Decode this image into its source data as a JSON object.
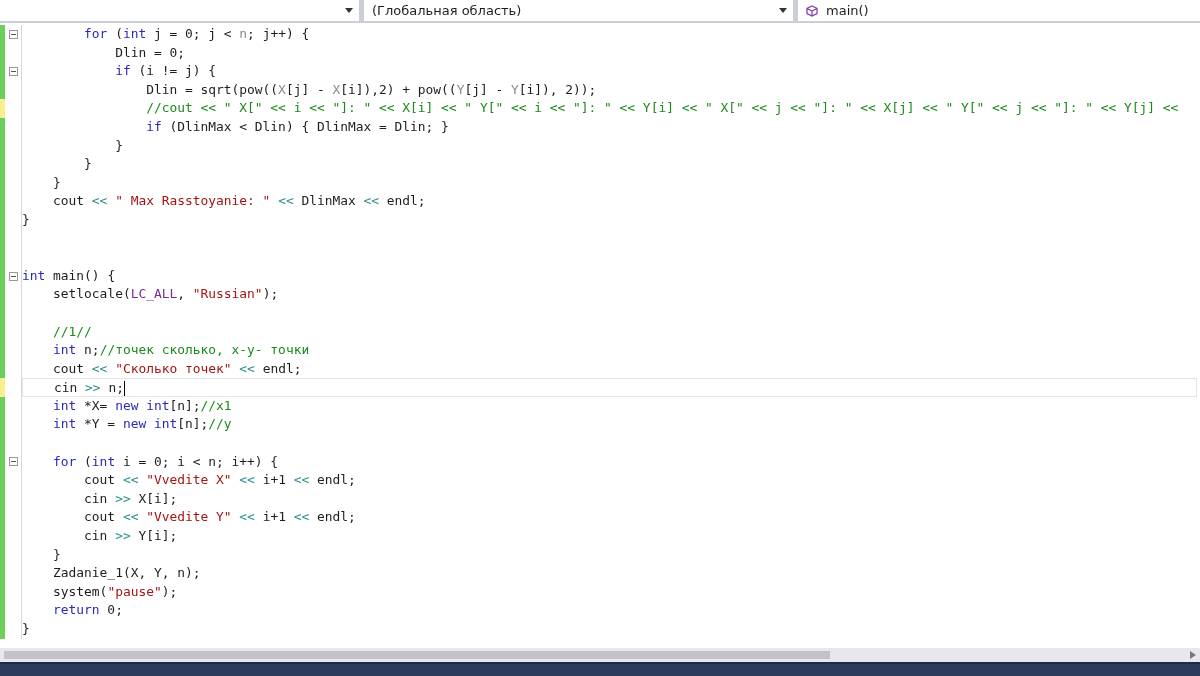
{
  "navigation_bar": {
    "scope": "(Глобальная область)",
    "member": "main()"
  },
  "editor": {
    "lines": [
      {
        "unsaved": false,
        "fold": true,
        "tokens": [
          {
            "kind": "keyword",
            "text": "        for"
          },
          {
            "kind": "plain",
            "text": " ("
          },
          {
            "kind": "keyword",
            "text": "int"
          },
          {
            "kind": "plain",
            "text": " j = 0; j < "
          },
          {
            "kind": "param",
            "text": "n"
          },
          {
            "kind": "plain",
            "text": "; j++) {"
          }
        ]
      },
      {
        "unsaved": false,
        "tokens": [
          {
            "kind": "plain",
            "text": "            Dlin = 0;"
          }
        ]
      },
      {
        "unsaved": false,
        "fold": true,
        "tokens": [
          {
            "kind": "keyword",
            "text": "            if"
          },
          {
            "kind": "plain",
            "text": " (i != j) {"
          }
        ]
      },
      {
        "unsaved": false,
        "tokens": [
          {
            "kind": "plain",
            "text": "                Dlin = sqrt(pow(("
          },
          {
            "kind": "param",
            "text": "X"
          },
          {
            "kind": "plain",
            "text": "[j] - "
          },
          {
            "kind": "param",
            "text": "X"
          },
          {
            "kind": "plain",
            "text": "[i]),2) + pow(("
          },
          {
            "kind": "param",
            "text": "Y"
          },
          {
            "kind": "plain",
            "text": "[j] - "
          },
          {
            "kind": "param",
            "text": "Y"
          },
          {
            "kind": "plain",
            "text": "[i]), 2));"
          }
        ]
      },
      {
        "unsaved": true,
        "tokens": [
          {
            "kind": "comment",
            "text": "                //cout << \" X[\" << i << \"]: \" << X[i] << \" Y[\" << i << \"]: \" << Y[i] << \" X[\" << j << \"]: \" << X[j] << \" Y[\" << j << \"]: \" << Y[j] <<"
          }
        ]
      },
      {
        "unsaved": false,
        "tokens": [
          {
            "kind": "keyword",
            "text": "                if"
          },
          {
            "kind": "plain",
            "text": " (DlinMax < Dlin) { DlinMax = Dlin; }"
          }
        ]
      },
      {
        "unsaved": false,
        "tokens": [
          {
            "kind": "plain",
            "text": "            }"
          }
        ]
      },
      {
        "unsaved": false,
        "tokens": [
          {
            "kind": "plain",
            "text": "        }"
          }
        ]
      },
      {
        "unsaved": false,
        "tokens": [
          {
            "kind": "plain",
            "text": "    }"
          }
        ]
      },
      {
        "unsaved": false,
        "tokens": [
          {
            "kind": "plain",
            "text": "    cout "
          },
          {
            "kind": "operator",
            "text": "<<"
          },
          {
            "kind": "string",
            "text": " \" Max Rasstoyanie: \""
          },
          {
            "kind": "operator",
            "text": " <<"
          },
          {
            "kind": "plain",
            "text": " DlinMax "
          },
          {
            "kind": "operator",
            "text": "<<"
          },
          {
            "kind": "plain",
            "text": " endl;"
          }
        ]
      },
      {
        "unsaved": false,
        "tokens": [
          {
            "kind": "plain",
            "text": "}"
          }
        ]
      },
      {
        "unsaved": false
      },
      {
        "unsaved": false
      },
      {
        "unsaved": false,
        "fold": true,
        "tokens": [
          {
            "kind": "keyword",
            "text": "int"
          },
          {
            "kind": "plain",
            "text": " main() {"
          }
        ]
      },
      {
        "unsaved": false,
        "tokens": [
          {
            "kind": "plain",
            "text": "    setlocale("
          },
          {
            "kind": "macro",
            "text": "LC_ALL"
          },
          {
            "kind": "plain",
            "text": ", "
          },
          {
            "kind": "string",
            "text": "\"Russian\""
          },
          {
            "kind": "plain",
            "text": ");"
          }
        ]
      },
      {
        "unsaved": false
      },
      {
        "unsaved": false,
        "tokens": [
          {
            "kind": "comment",
            "text": "    //1//"
          }
        ]
      },
      {
        "unsaved": false,
        "tokens": [
          {
            "kind": "keyword",
            "text": "    int"
          },
          {
            "kind": "plain",
            "text": " n;"
          },
          {
            "kind": "comment",
            "text": "//точек сколько, x-y- точки"
          }
        ]
      },
      {
        "unsaved": false,
        "tokens": [
          {
            "kind": "plain",
            "text": "    cout "
          },
          {
            "kind": "operator",
            "text": "<<"
          },
          {
            "kind": "string",
            "text": " \"Сколько точек\""
          },
          {
            "kind": "operator",
            "text": " <<"
          },
          {
            "kind": "plain",
            "text": " endl;"
          }
        ]
      },
      {
        "unsaved": true,
        "current": true,
        "tokens": [
          {
            "kind": "plain",
            "text": "    cin "
          },
          {
            "kind": "operator",
            "text": ">>"
          },
          {
            "kind": "plain",
            "text": " n;"
          }
        ]
      },
      {
        "unsaved": false,
        "tokens": [
          {
            "kind": "keyword",
            "text": "    int"
          },
          {
            "kind": "plain",
            "text": " *X= "
          },
          {
            "kind": "keyword",
            "text": "new"
          },
          {
            "kind": "keyword",
            "text": " int"
          },
          {
            "kind": "plain",
            "text": "[n];"
          },
          {
            "kind": "comment",
            "text": "//x1"
          }
        ]
      },
      {
        "unsaved": false,
        "tokens": [
          {
            "kind": "keyword",
            "text": "    int"
          },
          {
            "kind": "plain",
            "text": " *Y = "
          },
          {
            "kind": "keyword",
            "text": "new"
          },
          {
            "kind": "keyword",
            "text": " int"
          },
          {
            "kind": "plain",
            "text": "[n];"
          },
          {
            "kind": "comment",
            "text": "//y"
          }
        ]
      },
      {
        "unsaved": false
      },
      {
        "unsaved": false,
        "fold": true,
        "tokens": [
          {
            "kind": "keyword",
            "text": "    for"
          },
          {
            "kind": "plain",
            "text": " ("
          },
          {
            "kind": "keyword",
            "text": "int"
          },
          {
            "kind": "plain",
            "text": " i = 0; i < n; i++) {"
          }
        ]
      },
      {
        "unsaved": false,
        "tokens": [
          {
            "kind": "plain",
            "text": "        cout "
          },
          {
            "kind": "operator",
            "text": "<<"
          },
          {
            "kind": "string",
            "text": " \"Vvedite X\""
          },
          {
            "kind": "operator",
            "text": " <<"
          },
          {
            "kind": "plain",
            "text": " i+1 "
          },
          {
            "kind": "operator",
            "text": "<<"
          },
          {
            "kind": "plain",
            "text": " endl;"
          }
        ]
      },
      {
        "unsaved": false,
        "tokens": [
          {
            "kind": "plain",
            "text": "        cin "
          },
          {
            "kind": "operator",
            "text": ">>"
          },
          {
            "kind": "plain",
            "text": " X[i];"
          }
        ]
      },
      {
        "unsaved": false,
        "tokens": [
          {
            "kind": "plain",
            "text": "        cout "
          },
          {
            "kind": "operator",
            "text": "<<"
          },
          {
            "kind": "string",
            "text": " \"Vvedite Y\""
          },
          {
            "kind": "operator",
            "text": " <<"
          },
          {
            "kind": "plain",
            "text": " i+1 "
          },
          {
            "kind": "operator",
            "text": "<<"
          },
          {
            "kind": "plain",
            "text": " endl;"
          }
        ]
      },
      {
        "unsaved": false,
        "tokens": [
          {
            "kind": "plain",
            "text": "        cin "
          },
          {
            "kind": "operator",
            "text": ">>"
          },
          {
            "kind": "plain",
            "text": " Y[i];"
          }
        ]
      },
      {
        "unsaved": false,
        "tokens": [
          {
            "kind": "plain",
            "text": "    }"
          }
        ]
      },
      {
        "unsaved": false,
        "tokens": [
          {
            "kind": "plain",
            "text": "    Zadanie_1(X, Y, n);"
          }
        ]
      },
      {
        "unsaved": false,
        "tokens": [
          {
            "kind": "plain",
            "text": "    system("
          },
          {
            "kind": "string",
            "text": "\"pause\""
          },
          {
            "kind": "plain",
            "text": ");"
          }
        ]
      },
      {
        "unsaved": false,
        "tokens": [
          {
            "kind": "keyword",
            "text": "    return"
          },
          {
            "kind": "plain",
            "text": " 0;"
          }
        ]
      },
      {
        "unsaved": false,
        "tokens": [
          {
            "kind": "plain",
            "text": "}"
          }
        ]
      }
    ]
  }
}
